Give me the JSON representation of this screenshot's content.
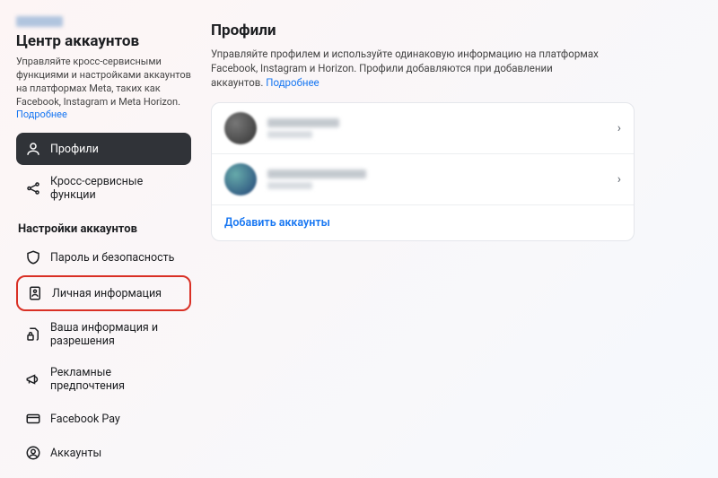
{
  "sidebar": {
    "title": "Центр аккаунтов",
    "description_pre": "Управляйте кросс-сервисными функциями и настройками аккаунтов на платформах Meta, таких как Facebook, Instagram и Meta Horizon. ",
    "learn_more": "Подробнее",
    "section_label": "Настройки аккаунтов",
    "items_top": [
      {
        "label": "Профили"
      },
      {
        "label": "Кросс-сервисные функции"
      }
    ],
    "items_settings": [
      {
        "label": "Пароль и безопасность"
      },
      {
        "label": "Личная информация"
      },
      {
        "label": "Ваша информация и разрешения"
      },
      {
        "label": "Рекламные предпочтения"
      },
      {
        "label": "Facebook Pay"
      },
      {
        "label": "Аккаунты"
      }
    ]
  },
  "main": {
    "title": "Профили",
    "description_pre": "Управляйте профилем и используйте одинаковую информацию на платформах Facebook, Instagram и Horizon. Профили добавляются при добавлении аккаунтов. ",
    "learn_more": "Подробнее",
    "add_label": "Добавить аккаунты"
  }
}
